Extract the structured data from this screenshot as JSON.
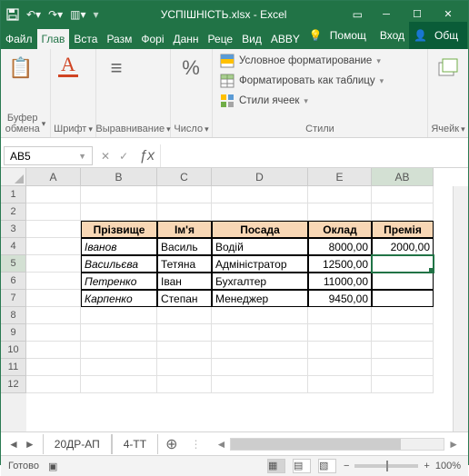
{
  "title": "УСПІШНІСТЬ.xlsx - Excel",
  "tabs": [
    "Файл",
    "Глав",
    "Вста",
    "Разм",
    "Форі",
    "Данн",
    "Реце",
    "Вид",
    "ABBY"
  ],
  "active_tab": 1,
  "help": "Помощ",
  "signin": "Вход",
  "share": "Общ",
  "ribbon_groups": {
    "clipboard": {
      "label": "Буфер\nобмена",
      "big": ""
    },
    "font": {
      "label": "Шрифт",
      "big": "А"
    },
    "align": {
      "label": "Выравнивание",
      "big": "≡"
    },
    "number": {
      "label": "Число",
      "big": "%"
    },
    "styles": {
      "label": "Стили",
      "items": [
        "Условное форматирование",
        "Форматировать как таблицу",
        "Стили ячеек"
      ]
    },
    "cells": {
      "label": "Ячейк"
    }
  },
  "namebox": "AB5",
  "columns": [
    {
      "name": "A",
      "w": 60
    },
    {
      "name": "B",
      "w": 84
    },
    {
      "name": "C",
      "w": 60
    },
    {
      "name": "D",
      "w": 106
    },
    {
      "name": "E",
      "w": 70
    },
    {
      "name": "AB",
      "w": 68
    }
  ],
  "row_count": 12,
  "selected_row": 5,
  "selected_col": 5,
  "table": {
    "header_row": 3,
    "headers": [
      "Прізвище",
      "Ім'я",
      "Посада",
      "Оклад",
      "Премія"
    ],
    "rows": [
      [
        "Іванов",
        "Василь",
        "Водій",
        "8000,00",
        "2000,00"
      ],
      [
        "Васильєва",
        "Тетяна",
        "Адміністратор",
        "12500,00",
        ""
      ],
      [
        "Петренко",
        "Іван",
        "Бухгалтер",
        "11000,00",
        ""
      ],
      [
        "Карпенко",
        "Степан",
        "Менеджер",
        "9450,00",
        ""
      ]
    ]
  },
  "sheets": [
    "20ДР-АП",
    "4-ТТ"
  ],
  "status": "Готово",
  "zoom": "100%"
}
